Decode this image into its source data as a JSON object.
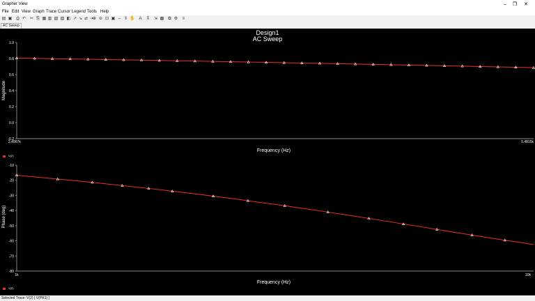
{
  "window": {
    "title": "Grapher View",
    "minimize_glyph": "–",
    "maximize_glyph": "❐",
    "close_glyph": "✕"
  },
  "menu": [
    "File",
    "Edit",
    "View",
    "Graph",
    "Trace",
    "Cursor",
    "Legend",
    "Tools",
    "Help"
  ],
  "toolbar_icons": [
    "open-icon",
    "save-icon",
    "print-icon",
    "undo-icon",
    "cut-icon",
    "copy-icon",
    "paste-icon",
    "grid-icon",
    "grid-toggle-icon",
    "legend-icon",
    "color-icon",
    "cursor-icon",
    "cursor-pair-icon",
    "cursor-move-icon",
    "cursor-next-icon",
    "zoom-in-icon",
    "zoom-out-icon",
    "zoom-fit-icon",
    "zoom-area-icon",
    "zoom-x-icon",
    "zoom-y-icon",
    "pan-icon",
    "text-icon",
    "markers-icon",
    "export-icon",
    "export-image-icon",
    "copy-graph-icon",
    "properties-icon",
    "settings-icon"
  ],
  "tab": {
    "label": "AC Sweep"
  },
  "status": {
    "text": "Selected Trace: V(2) [ V(PR1) ]"
  },
  "colors": {
    "trace": "#e8312a",
    "marker": "#ffffff",
    "background": "#000000",
    "axis": "#888888",
    "text": "#ffffff"
  },
  "chart_data": [
    {
      "type": "line",
      "title": "Design1",
      "subtitle": "AC Sweep",
      "xlabel": "Frequency (Hz)",
      "ylabel": "Magnitude",
      "x_tick_labels": [
        "2.4967k",
        "5.4815k"
      ],
      "y_tick_labels": [
        "1.0",
        "0.8",
        "0.6",
        "0.4",
        "0.2",
        "0.0",
        "-0.2"
      ],
      "ylim": [
        -0.2,
        1.0
      ],
      "legend": "hidden",
      "series": [
        {
          "x": [
            2.5,
            2.6,
            2.7,
            2.8,
            2.9,
            3.0,
            3.1,
            3.2,
            3.3,
            3.4,
            3.5,
            3.6,
            3.7,
            3.8,
            3.9,
            4.0,
            4.1,
            4.2,
            4.3,
            4.4,
            4.5,
            4.6,
            4.7,
            4.8,
            4.9,
            5.0,
            5.1,
            5.2,
            5.3,
            5.4
          ],
          "y": [
            0.805,
            0.802,
            0.798,
            0.795,
            0.791,
            0.787,
            0.784,
            0.78,
            0.776,
            0.772,
            0.768,
            0.764,
            0.76,
            0.756,
            0.752,
            0.748,
            0.744,
            0.74,
            0.736,
            0.731,
            0.727,
            0.723,
            0.718,
            0.714,
            0.709,
            0.705,
            0.7,
            0.696,
            0.691,
            0.686
          ]
        }
      ]
    },
    {
      "type": "line",
      "xlabel": "Frequency (Hz)",
      "ylabel": "Phase (deg)",
      "x_tick_labels": [
        "1k",
        "10k"
      ],
      "y_tick_labels": [
        "-10",
        "-20",
        "-30",
        "-40",
        "-50",
        "-60",
        "-70",
        "-80"
      ],
      "ylim": [
        -80,
        -10
      ],
      "x_scale": "log",
      "xlim": [
        1000,
        10000
      ],
      "legend_labels": [
        "V(2)",
        "V(2)"
      ],
      "series": [
        {
          "x": [
            1000,
            1100,
            1200,
            1300,
            1400,
            1500,
            1600,
            1700,
            1800,
            1900,
            2000,
            2200,
            2400,
            2600,
            2800,
            3000,
            3300,
            3600,
            4000,
            4400,
            4800,
            5200,
            5600,
            6000,
            6500,
            7000,
            7600,
            8200,
            8800,
            9400
          ],
          "y": [
            -16.7,
            -18.0,
            -19.2,
            -20.3,
            -21.4,
            -22.5,
            -23.5,
            -24.5,
            -25.4,
            -26.3,
            -27.2,
            -28.9,
            -30.5,
            -32.0,
            -33.5,
            -34.9,
            -36.8,
            -38.7,
            -41.0,
            -43.2,
            -45.2,
            -47.1,
            -48.9,
            -50.5,
            -52.5,
            -54.3,
            -56.2,
            -58.0,
            -59.6,
            -61.0
          ]
        }
      ]
    }
  ]
}
